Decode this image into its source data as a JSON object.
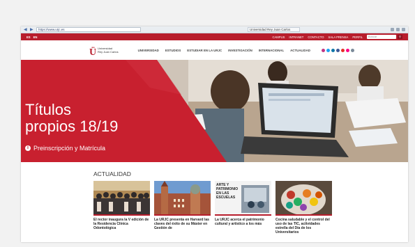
{
  "browser": {
    "url": "https://www.urjc.es",
    "tab_title": "Universidad Rey Juan Carlos"
  },
  "topbar": {
    "langs": [
      "ES",
      "EN"
    ],
    "links": [
      "CAMPUS",
      "INTRANET",
      "CONTACTO",
      "SALA PRENSA",
      "PERFIL"
    ],
    "search_placeholder": "Buscar"
  },
  "header": {
    "logo_line1": "Universidad",
    "logo_line2": "Rey Juan Carlos",
    "menu": [
      "UNIVERSIDAD",
      "ESTUDIOS",
      "ESTUDIAR EN LA URJC",
      "INVESTIGACIÓN",
      "INTERNACIONAL",
      "ACTUALIDAD"
    ]
  },
  "hero": {
    "title_line1": "Títulos",
    "title_line2": "propios 18/19",
    "link": "Preinscripción y Matrícula"
  },
  "news": {
    "heading": "ACTUALIDAD",
    "items": [
      {
        "caption": "El rector inaugura la V edición de la Residencia Clínica Odontológica"
      },
      {
        "caption": "La URJC presenta en Harvard las claves del éxito de su Máster en Gestión de"
      },
      {
        "caption": "La URJC acerca el patrimonio cultural y artístico a los más"
      },
      {
        "caption": "Cocina saludable y el control del uso de las TIC, actividades estrella del Día de los Universitarios"
      }
    ],
    "card3_text": "ARTE Y PATRIMONIO EN LAS ESCUELAS"
  },
  "colors": {
    "brand_red": "#b81d2c",
    "hero_red": "#c8202f"
  }
}
